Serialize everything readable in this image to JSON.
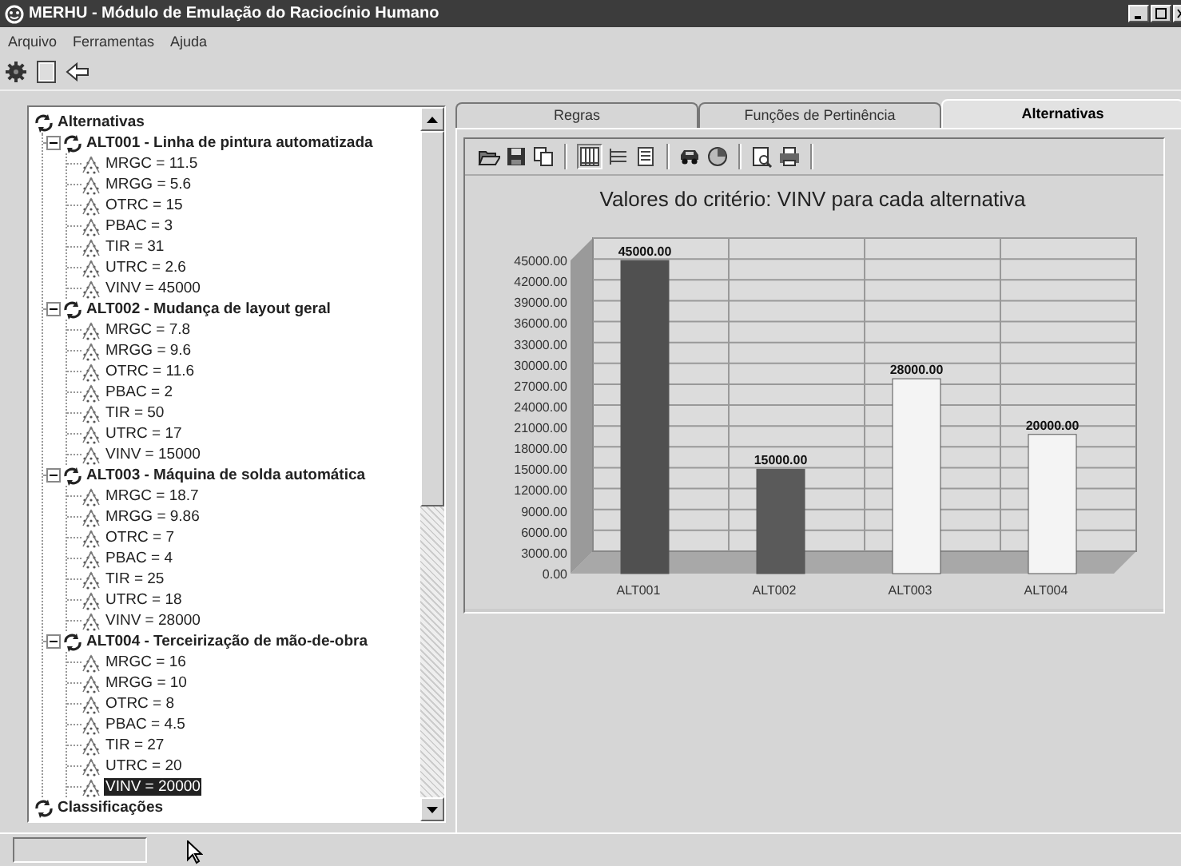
{
  "window": {
    "title": "MERHU - Módulo de Emulação do Raciocínio Humano"
  },
  "menu": [
    "Arquivo",
    "Ferramentas",
    "Ajuda"
  ],
  "tree": [
    {
      "label": "Alternativas",
      "kind": "root",
      "selected": false,
      "children": [
        {
          "label": "ALT001 - Linha de pintura automatizada",
          "kind": "group",
          "expanded": true,
          "selected": false,
          "children": [
            {
              "label": "MRGC = 11.5",
              "kind": "leaf",
              "selected": false
            },
            {
              "label": "MRGG = 5.6",
              "kind": "leaf",
              "selected": false
            },
            {
              "label": "OTRC = 15",
              "kind": "leaf",
              "selected": false
            },
            {
              "label": "PBAC = 3",
              "kind": "leaf",
              "selected": false
            },
            {
              "label": "TIR = 31",
              "kind": "leaf",
              "selected": false
            },
            {
              "label": "UTRC = 2.6",
              "kind": "leaf",
              "selected": false
            },
            {
              "label": "VINV = 45000",
              "kind": "leaf",
              "selected": false
            }
          ]
        },
        {
          "label": "ALT002 - Mudança de layout geral",
          "kind": "group",
          "expanded": true,
          "selected": false,
          "children": [
            {
              "label": "MRGC = 7.8",
              "kind": "leaf",
              "selected": false
            },
            {
              "label": "MRGG = 9.6",
              "kind": "leaf",
              "selected": false
            },
            {
              "label": "OTRC = 11.6",
              "kind": "leaf",
              "selected": false
            },
            {
              "label": "PBAC = 2",
              "kind": "leaf",
              "selected": false
            },
            {
              "label": "TIR = 50",
              "kind": "leaf",
              "selected": false
            },
            {
              "label": "UTRC = 17",
              "kind": "leaf",
              "selected": false
            },
            {
              "label": "VINV = 15000",
              "kind": "leaf",
              "selected": false
            }
          ]
        },
        {
          "label": "ALT003 - Máquina de solda automática",
          "kind": "group",
          "expanded": true,
          "selected": false,
          "children": [
            {
              "label": "MRGC = 18.7",
              "kind": "leaf",
              "selected": false
            },
            {
              "label": "MRGG = 9.86",
              "kind": "leaf",
              "selected": false
            },
            {
              "label": "OTRC = 7",
              "kind": "leaf",
              "selected": false
            },
            {
              "label": "PBAC = 4",
              "kind": "leaf",
              "selected": false
            },
            {
              "label": "TIR = 25",
              "kind": "leaf",
              "selected": false
            },
            {
              "label": "UTRC = 18",
              "kind": "leaf",
              "selected": false
            },
            {
              "label": "VINV = 28000",
              "kind": "leaf",
              "selected": false
            }
          ]
        },
        {
          "label": "ALT004 - Terceirização de mão-de-obra",
          "kind": "group",
          "expanded": true,
          "selected": false,
          "children": [
            {
              "label": "MRGC = 16",
              "kind": "leaf",
              "selected": false
            },
            {
              "label": "MRGG = 10",
              "kind": "leaf",
              "selected": false
            },
            {
              "label": "OTRC = 8",
              "kind": "leaf",
              "selected": false
            },
            {
              "label": "PBAC = 4.5",
              "kind": "leaf",
              "selected": false
            },
            {
              "label": "TIR = 27",
              "kind": "leaf",
              "selected": false
            },
            {
              "label": "UTRC = 20",
              "kind": "leaf",
              "selected": false
            },
            {
              "label": "VINV = 20000",
              "kind": "leaf",
              "selected": true
            }
          ]
        }
      ]
    },
    {
      "label": "Classificações",
      "kind": "root",
      "selected": false
    }
  ],
  "tabs": [
    {
      "label": "Regras",
      "selected": false
    },
    {
      "label": "Funções de Pertinência",
      "selected": false
    },
    {
      "label": "Alternativas",
      "selected": true
    }
  ],
  "chart_data": {
    "type": "bar",
    "title": "Valores do critério: VINV para cada alternativa",
    "categories": [
      "ALT001",
      "ALT002",
      "ALT003",
      "ALT004"
    ],
    "series": [
      {
        "values": [
          45000,
          15000,
          28000,
          20000
        ],
        "colors": [
          "#505050",
          "#5a5a5a",
          "#f4f4f4",
          "#f4f4f4"
        ]
      }
    ],
    "ylim": [
      0,
      45000
    ],
    "grid": true,
    "yticks": [
      {
        "value": 0,
        "label": "0.00"
      },
      {
        "value": 3000,
        "label": "3000.00"
      },
      {
        "value": 6000,
        "label": "6000.00"
      },
      {
        "value": 9000,
        "label": "9000.00"
      },
      {
        "value": 12000,
        "label": "12000.00"
      },
      {
        "value": 15000,
        "label": "15000.00"
      },
      {
        "value": 18000,
        "label": "18000.00"
      },
      {
        "value": 21000,
        "label": "21000.00"
      },
      {
        "value": 24000,
        "label": "24000.00"
      },
      {
        "value": 27000,
        "label": "27000.00"
      },
      {
        "value": 30000,
        "label": "30000.00"
      },
      {
        "value": 33000,
        "label": "33000.00"
      },
      {
        "value": 36000,
        "label": "36000.00"
      },
      {
        "value": 39000,
        "label": "39000.00"
      },
      {
        "value": 42000,
        "label": "42000.00"
      },
      {
        "value": 45000,
        "label": "45000.00"
      }
    ],
    "value_labels": [
      "45000.00",
      "15000.00",
      "28000.00",
      "20000.00"
    ]
  }
}
